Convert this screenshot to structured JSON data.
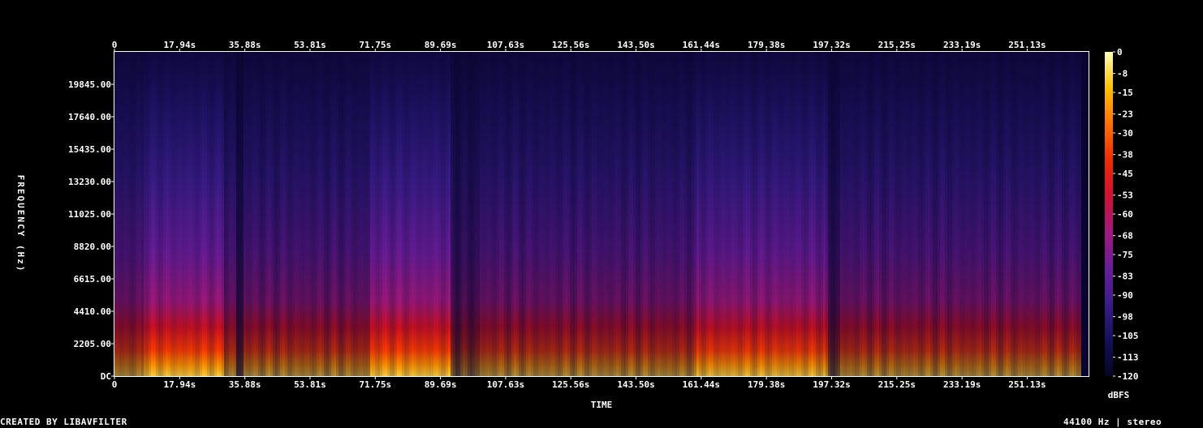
{
  "chart_data": {
    "type": "heatmap",
    "title": "",
    "xlabel": "TIME",
    "ylabel": "FREQUENCY (Hz)",
    "x_ticks": [
      "0",
      "17.94s",
      "35.88s",
      "53.81s",
      "71.75s",
      "89.69s",
      "107.63s",
      "125.56s",
      "143.50s",
      "161.44s",
      "179.38s",
      "197.32s",
      "215.25s",
      "233.19s",
      "251.13s"
    ],
    "x_tick_values": [
      0,
      17.94,
      35.88,
      53.81,
      71.75,
      89.69,
      107.63,
      125.56,
      143.5,
      161.44,
      179.38,
      197.32,
      215.25,
      233.19,
      251.13
    ],
    "xlim": [
      0,
      268
    ],
    "y_ticks": [
      "DC",
      "2205.00",
      "4410.00",
      "6615.00",
      "8820.00",
      "11025.00",
      "13230.00",
      "15435.00",
      "17640.00",
      "19845.00"
    ],
    "y_tick_values": [
      0,
      2205,
      4410,
      6615,
      8820,
      11025,
      13230,
      15435,
      17640,
      19845
    ],
    "ylim": [
      0,
      22050
    ],
    "colorbar": {
      "label": "dBFS",
      "ticks": [
        "0",
        "-8",
        "-15",
        "-23",
        "-30",
        "-38",
        "-45",
        "-53",
        "-60",
        "-68",
        "-75",
        "-83",
        "-90",
        "-98",
        "-105",
        "-113",
        "-120"
      ],
      "tick_values": [
        0,
        -8,
        -15,
        -23,
        -30,
        -38,
        -45,
        -53,
        -60,
        -68,
        -75,
        -83,
        -90,
        -98,
        -105,
        -113,
        -120
      ],
      "range": [
        -120,
        0
      ],
      "colors": [
        "#050520",
        "#14105c",
        "#3a1c8a",
        "#6a1d9a",
        "#a01880",
        "#d01035",
        "#f02a00",
        "#ff7000",
        "#ffc000",
        "#ffffb8"
      ]
    },
    "grid": false,
    "legend": "right"
  },
  "footer": {
    "left": "CREATED BY LIBAVFILTER",
    "right": "44100 Hz | stereo"
  }
}
